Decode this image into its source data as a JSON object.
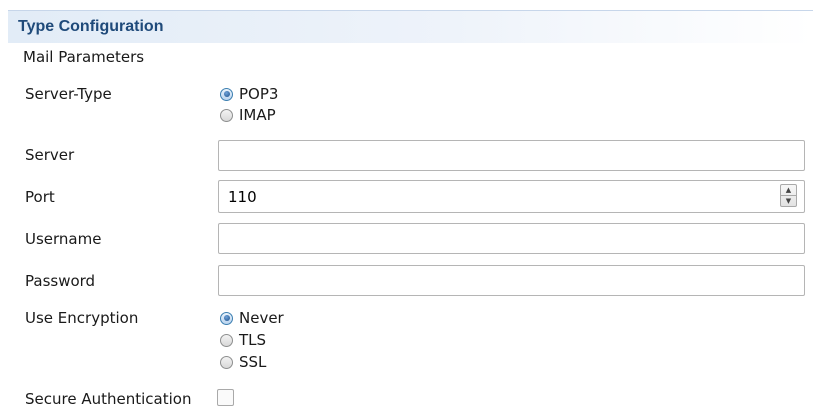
{
  "section": {
    "title": "Type Configuration"
  },
  "group": {
    "title": "Mail Parameters"
  },
  "server_type": {
    "label": "Server-Type",
    "options": [
      "POP3",
      "IMAP"
    ],
    "selected": "POP3"
  },
  "server": {
    "label": "Server",
    "value": ""
  },
  "port": {
    "label": "Port",
    "value": "110"
  },
  "username": {
    "label": "Username",
    "value": ""
  },
  "password": {
    "label": "Password",
    "value": ""
  },
  "encryption": {
    "label": "Use Encryption",
    "options": [
      "Never",
      "TLS",
      "SSL"
    ],
    "selected": "Never"
  },
  "secure_auth": {
    "label": "Secure Authentication",
    "checked": false
  }
}
